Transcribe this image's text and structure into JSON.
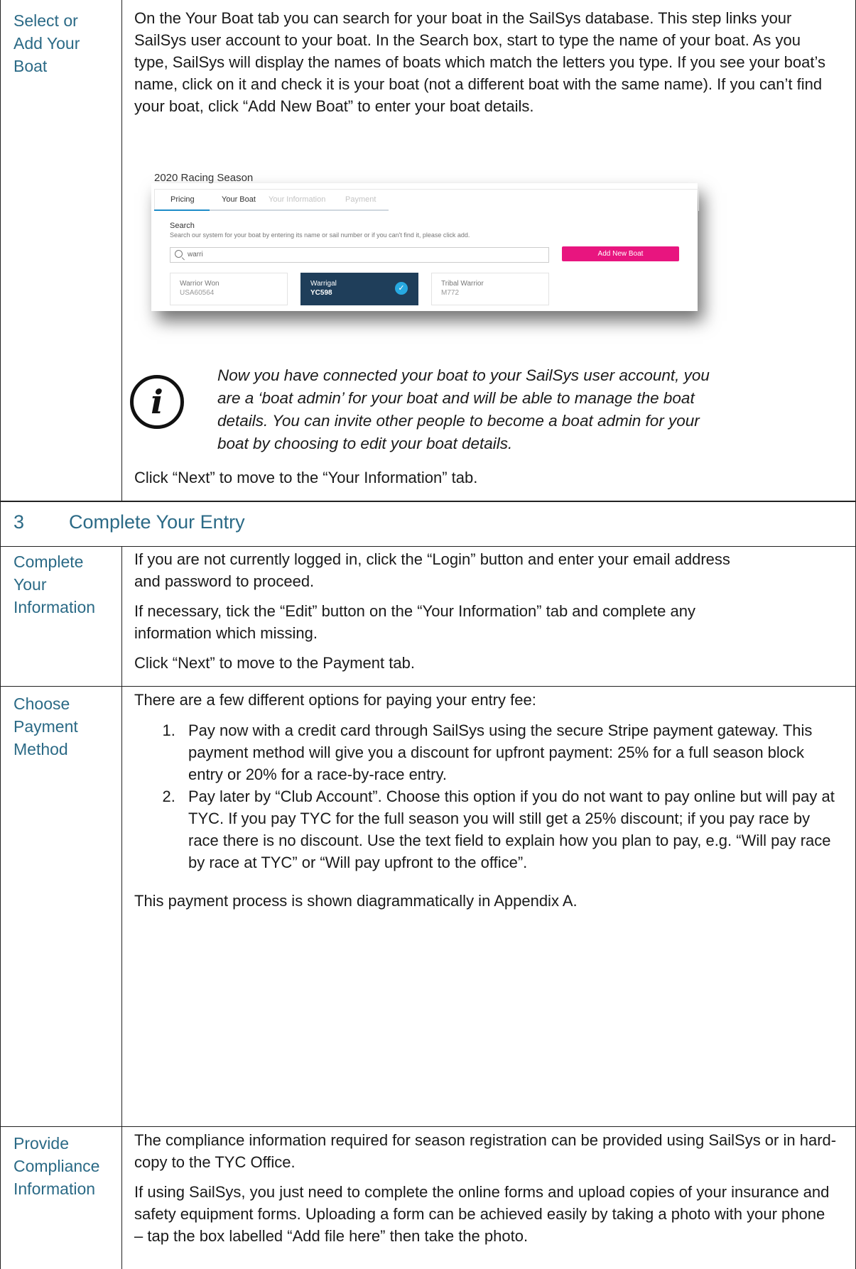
{
  "row1": {
    "label": [
      "Select or",
      "Add Your",
      "Boat"
    ],
    "para": "On the Your Boat tab you can search for your boat in the SailSys database.  This step links your SailSys user account to your boat.  In the Search box, start to type the name of your boat.  As you type, SailSys will display the names of boats which match the letters you type.  If you see your boat’s name, click on it and check it is your boat (not a different boat with the same name). If you can’t find your boat, click “Add New Boat” to enter your boat details.",
    "info_icon": "info-circle-icon",
    "note": "Now you have connected your boat to your SailSys user account, you are a ‘boat admin’ for your boat and will be able to manage the boat details.  You can invite other people to become a boat admin for your boat by choosing to edit your boat details.",
    "next": "Click “Next” to move to the “Your Information” tab."
  },
  "screenshot": {
    "title": "2020 Racing Season",
    "tabs": [
      "Pricing",
      "Your Boat",
      "Your Information",
      "Payment"
    ],
    "search_label": "Search",
    "search_hint": "Search our system for your boat by entering its name or sail number or if you can't find it, please click add.",
    "search_value": "warri",
    "add_button": "Add New Boat",
    "cards": [
      {
        "name": "Warrior Won",
        "sail": "USA60564",
        "selected": false
      },
      {
        "name": "Warrigal",
        "sail": "YC598",
        "selected": true
      },
      {
        "name": "Tribal Warrior",
        "sail": "M772",
        "selected": false
      }
    ],
    "colors": {
      "accent": "#e8157f",
      "selected": "#1f3e5a",
      "check": "#27a9e1"
    }
  },
  "section": {
    "number": "3",
    "title": "Complete Your Entry"
  },
  "row2": {
    "label": [
      "Complete",
      "Your",
      "Information"
    ],
    "p1": "If you are not currently logged in, click the “Login” button and enter your email address and password to proceed.",
    "p2": "If necessary, tick the “Edit” button on the “Your Information” tab and complete any information which missing.",
    "p3": "Click “Next” to move to the Payment tab."
  },
  "row3": {
    "label": [
      "Choose",
      "Payment",
      "Method"
    ],
    "intro": "There are a few different options for paying your entry fee:",
    "items": [
      "Pay now with a credit card through SailSys using the secure Stripe payment gateway.  This payment method will give you a discount for upfront payment: 25% for a full season block entry or 20% for a race-by-race entry.",
      "Pay later by “Club Account”. Choose this option if you do not want to pay online but will pay at TYC. If you pay TYC for the full season you will still get a 25% discount; if you pay race by race there is no discount. Use the text field to explain how you plan to pay, e.g. “Will pay race by race at TYC” or “Will pay upfront to the office”."
    ],
    "outro": "This payment process is shown diagrammatically in Appendix A."
  },
  "row4": {
    "label": [
      "Provide",
      "Compliance",
      "Information"
    ],
    "p1": "The compliance information required for season registration can be provided using SailSys or in hard-copy to the TYC Office.",
    "p2": " If using SailSys, you just need to complete the online forms and upload copies of your insurance and safety equipment forms.  Uploading a form can be achieved easily by taking a photo with your phone – tap the box labelled “Add file here” then take the photo."
  }
}
